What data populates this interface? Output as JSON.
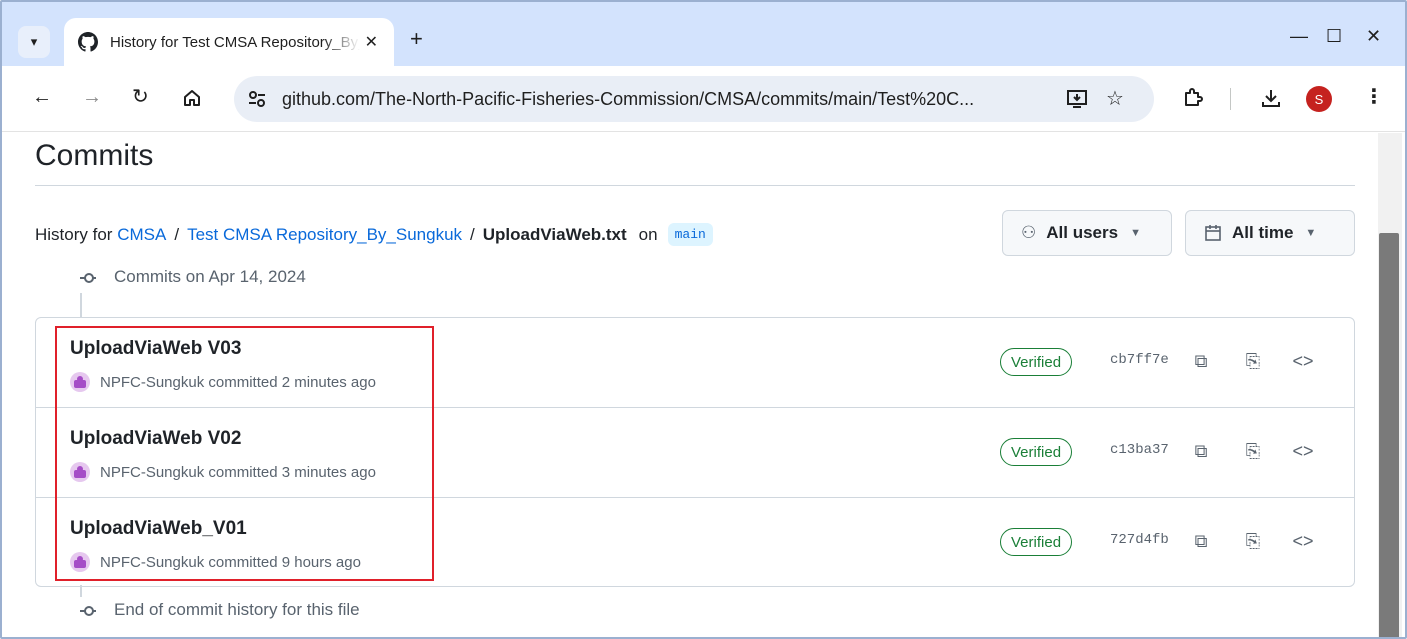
{
  "browser": {
    "tab_title": "History for Test CMSA Repository_By_Sungkuk",
    "tab_close": "✕",
    "new_tab": "+",
    "window_controls": {
      "minimize": "—",
      "maximize": "☐",
      "close": "✕"
    },
    "url": "github.com/The-North-Pacific-Fisheries-Commission/CMSA/commits/main/Test%20C...",
    "profile_initial": "S",
    "icons": {
      "tab_dropdown": "chevron-down-icon",
      "back": "back-arrow-icon",
      "forward": "forward-arrow-icon",
      "reload": "reload-icon",
      "home": "home-icon",
      "site_info": "tune-icon",
      "install": "install-app-icon",
      "bookmark": "star-icon",
      "extensions": "puzzle-icon",
      "downloads": "download-icon",
      "menu": "kebab-menu-icon"
    }
  },
  "page": {
    "title": "Commits",
    "history": {
      "prefix": "History for",
      "owner_repo": "CMSA",
      "sep1": "/",
      "folder": "Test CMSA Repository_By_Sungkuk",
      "sep2": "/",
      "file": "UploadViaWeb.txt",
      "on": "on",
      "branch": "main"
    },
    "filters": {
      "users_label": "All users",
      "time_label": "All time"
    },
    "group_label": "Commits on Apr 14, 2024",
    "end_label": "End of commit history for this file",
    "commits": [
      {
        "message": "UploadViaWeb V03",
        "author": "NPFC-Sungkuk",
        "when": "committed 2 minutes ago",
        "verified": "Verified",
        "sha": "cb7ff7e"
      },
      {
        "message": "UploadViaWeb V02",
        "author": "NPFC-Sungkuk",
        "when": "committed 3 minutes ago",
        "verified": "Verified",
        "sha": "c13ba37"
      },
      {
        "message": "UploadViaWeb_V01",
        "author": "NPFC-Sungkuk",
        "when": "committed 9 hours ago",
        "verified": "Verified",
        "sha": "727d4fb"
      }
    ]
  },
  "colors": {
    "link": "#0969da",
    "verified": "#1a7f37",
    "highlight_box": "#e0202a",
    "tab_strip": "#d3e3fd"
  }
}
